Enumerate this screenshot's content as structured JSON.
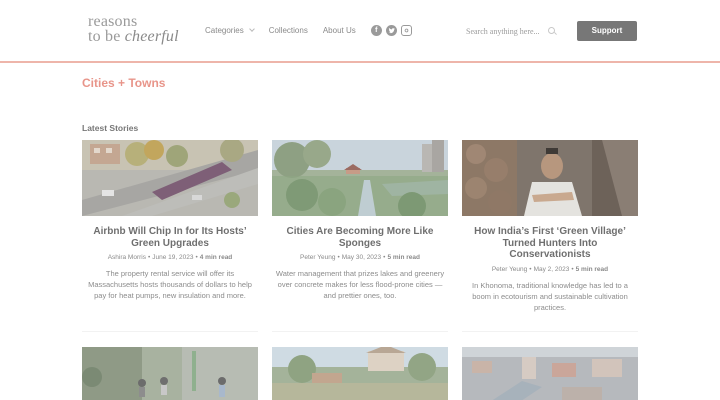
{
  "logo": {
    "line1": "reasons",
    "line2_a": "to be ",
    "line2_b": "cheerful"
  },
  "nav": {
    "items": [
      {
        "label": "Categories"
      },
      {
        "label": "Collections"
      },
      {
        "label": "About Us"
      }
    ],
    "social": [
      "facebook-icon",
      "twitter-icon",
      "instagram-icon"
    ]
  },
  "search": {
    "placeholder": "Search anything here..."
  },
  "support": {
    "label": "Support"
  },
  "page_title": "Cities + Towns",
  "section_title": "Latest Stories",
  "colors": {
    "accent": "#e8958a",
    "divider": "#eeb5aa",
    "button": "#777777",
    "logo_highlight": "#f3eba4"
  },
  "articles": [
    {
      "title": "Airbnb Will Chip In for Its Hosts’ Green Upgrades",
      "author": "Ashira Morris",
      "date": "June 19, 2023",
      "read": "4 min read",
      "excerpt": "The property rental service will offer its Massachusetts hosts thousands of dollars to help pay for heat pumps, new insulation and more."
    },
    {
      "title": "Cities Are Becoming More Like Sponges",
      "author": "Peter Yeung",
      "date": "May 30, 2023",
      "read": "5 min read",
      "excerpt": "Water management that prizes lakes and greenery over concrete makes for less flood-prone cities — and prettier ones, too."
    },
    {
      "title": "How India’s First ‘Green Village’ Turned Hunters Into Conservationists",
      "author": "Peter Yeung",
      "date": "May 2, 2023",
      "read": "5 min read",
      "excerpt": "In Khonoma, traditional knowledge has led to a boom in ecotourism and sustainable cultivation practices."
    }
  ]
}
